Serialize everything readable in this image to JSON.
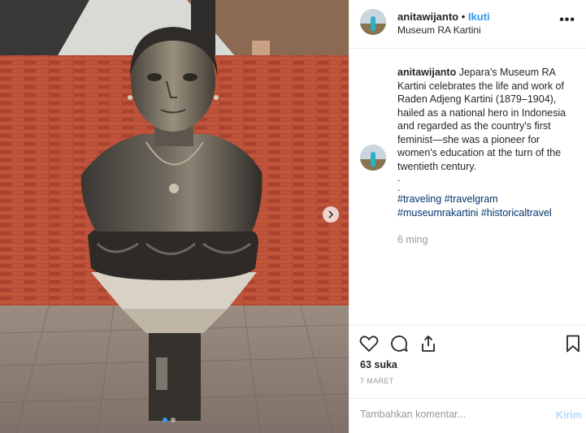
{
  "post": {
    "username": "anitawijanto",
    "separator": "•",
    "follow_label": "Ikuti",
    "location": "Museum RA Kartini",
    "more_label": "•••",
    "caption_user": "anitawijanto",
    "caption_text": "Jepara's Museum RA Kartini celebrates the life and work of Raden Adjeng Kartini (1879–1904), hailed as a national hero in Indonesia and regarded as the country's first feminist—she was a pioneer for women's education at the turn of the twentieth century.",
    "caption_dot1": ".",
    "caption_dot2": ".",
    "hashtags": [
      "#traveling",
      "#travelgram",
      "#museumrakartini",
      "#historicaltravel"
    ],
    "time_ago": "6 ming",
    "likes": "63 suka",
    "date": "7 MARET",
    "comment_placeholder": "Tambahkan komentar...",
    "post_label": "Kirim"
  },
  "icons": {
    "like": "heart-outline-icon",
    "comment": "speech-bubble-icon",
    "share": "share-arrow-icon",
    "save": "bookmark-icon",
    "next": "chevron-right-icon"
  },
  "carousel": {
    "total": 2,
    "active": 1
  },
  "colors": {
    "link": "#3897f0",
    "hashtag": "#003569",
    "muted": "#999999",
    "post_disabled": "#b3dbff"
  }
}
